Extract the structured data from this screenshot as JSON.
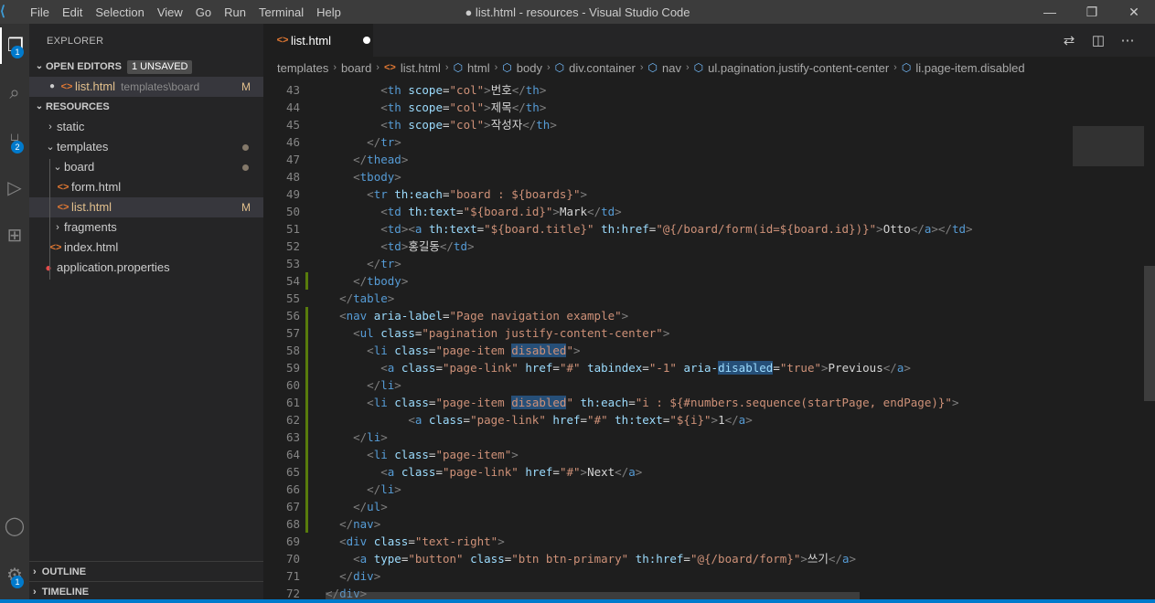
{
  "window": {
    "title": "● list.html - resources - Visual Studio Code",
    "menus": [
      "File",
      "Edit",
      "Selection",
      "View",
      "Go",
      "Run",
      "Terminal",
      "Help"
    ],
    "controls": {
      "minimize": "—",
      "maximize": "❐",
      "close": "✕"
    }
  },
  "activity": {
    "explorer_badge": "1",
    "scm_badge": "2",
    "settings_badge": "1"
  },
  "sidebar": {
    "title": "EXPLORER",
    "open_editors": {
      "label": "OPEN EDITORS",
      "unsaved": "1 UNSAVED",
      "items": [
        {
          "name": "list.html",
          "path": "templates\\board",
          "status": "M"
        }
      ]
    },
    "root": "RESOURCES",
    "tree": {
      "static": "static",
      "templates": "templates",
      "board": "board",
      "form": "form.html",
      "list": "list.html",
      "list_status": "M",
      "fragments": "fragments",
      "index": "index.html",
      "app": "application.properties"
    },
    "outline": "OUTLINE",
    "timeline": "TIMELINE"
  },
  "tab": {
    "label": "list.html"
  },
  "breadcrumb": [
    "templates",
    "board",
    "list.html",
    "html",
    "body",
    "div.container",
    "nav",
    "ul.pagination.justify-content-center",
    "li.page-item.disabled"
  ],
  "code": {
    "line_numbers": [
      "43",
      "44",
      "45",
      "46",
      "47",
      "48",
      "49",
      "50",
      "51",
      "52",
      "53",
      "54",
      "55",
      "56",
      "57",
      "58",
      "59",
      "60",
      "61",
      "62",
      "63",
      "64",
      "65",
      "66",
      "67",
      "68",
      "69",
      "70",
      "71",
      "72"
    ],
    "th_num": "번호",
    "th_title": "제목",
    "th_author": "작성자",
    "each_boards": "\"board : ${boards}\"",
    "text_id": "\"${board.id}\"",
    "mark": "Mark",
    "text_title": "\"${board.title}\"",
    "href_form": "\"@{/board/form(id=${board.id})}\"",
    "otto": "Otto",
    "name_kor": "홍길동",
    "aria_label": "\"Page navigation example\"",
    "ul_class": "\"pagination justify-content-center\"",
    "li_class_pre": "\"page-item ",
    "disabled": "disabled",
    "quote": "\"",
    "link_class": "\"page-link\"",
    "hash": "\"#\"",
    "tabindex": "\"-1\"",
    "aria_pre": "aria-",
    "aria_true": "\"true\"",
    "previous": "Previous",
    "each_seq": "\"i : ${#numbers.sequence(startPage, endPage)}\"",
    "text_i": "\"${i}\"",
    "one": "1",
    "page_item": "\"page-item\"",
    "next": "Next",
    "text_right": "\"text-right\"",
    "button": "\"button\"",
    "btn_class": "\"btn btn-primary\"",
    "href_form2": "\"@{/board/form}\"",
    "write": "쓰기",
    "col": "\"col\""
  },
  "colors": {
    "accent": "#007acc",
    "modified": "#e2c08d",
    "tag": "#569cd6",
    "attr": "#9cdcfe",
    "string": "#ce9178"
  }
}
